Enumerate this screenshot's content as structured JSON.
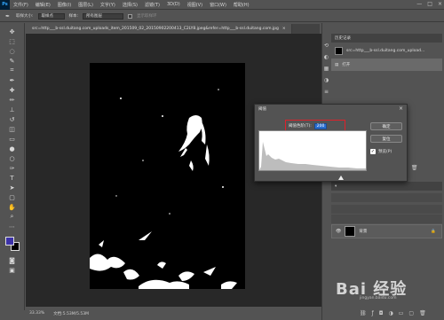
{
  "menu": {
    "logo": "Ps",
    "items": [
      "文件(F)",
      "编辑(E)",
      "图像(I)",
      "图层(L)",
      "文字(Y)",
      "选择(S)",
      "滤镜(T)",
      "3D(D)",
      "视图(V)",
      "窗口(W)",
      "帮助(H)"
    ],
    "window_controls": [
      "—",
      "□",
      "×"
    ]
  },
  "options_bar": {
    "sample_size_label": "取样大小:",
    "sample_size_value": "取样点",
    "sample_label": "样本:",
    "sample_value": "所有图层",
    "show_ring_label": "显示取样环"
  },
  "document": {
    "tab_title": "src=http___b-ssl.duitang.com_uploads_item_201509_02_20150902200413_C2LY8.jpeg&refer=http___b-ssl.duitang.com.jpg",
    "zoom": "33.33%",
    "doc_info": "文档:5.53M/5.53M"
  },
  "history_panel": {
    "tab": "历史记录",
    "snapshot_name": "src=http___b-ssl.duitang.com_upload...",
    "items": [
      "打开"
    ]
  },
  "layers_panel": {
    "layer_name": "背景"
  },
  "threshold_dialog": {
    "title": "阈值",
    "label": "阈值色阶(T):",
    "value": "200",
    "ok_label": "确定",
    "reset_label": "复位",
    "preview_label": "预览(P)"
  },
  "colors": {
    "foreground": "#3c32a8",
    "background": "#000000",
    "accent_box": "#e0202a"
  },
  "watermark": {
    "text": "Bai 经验",
    "sub": "jingyan.baidu.com"
  }
}
